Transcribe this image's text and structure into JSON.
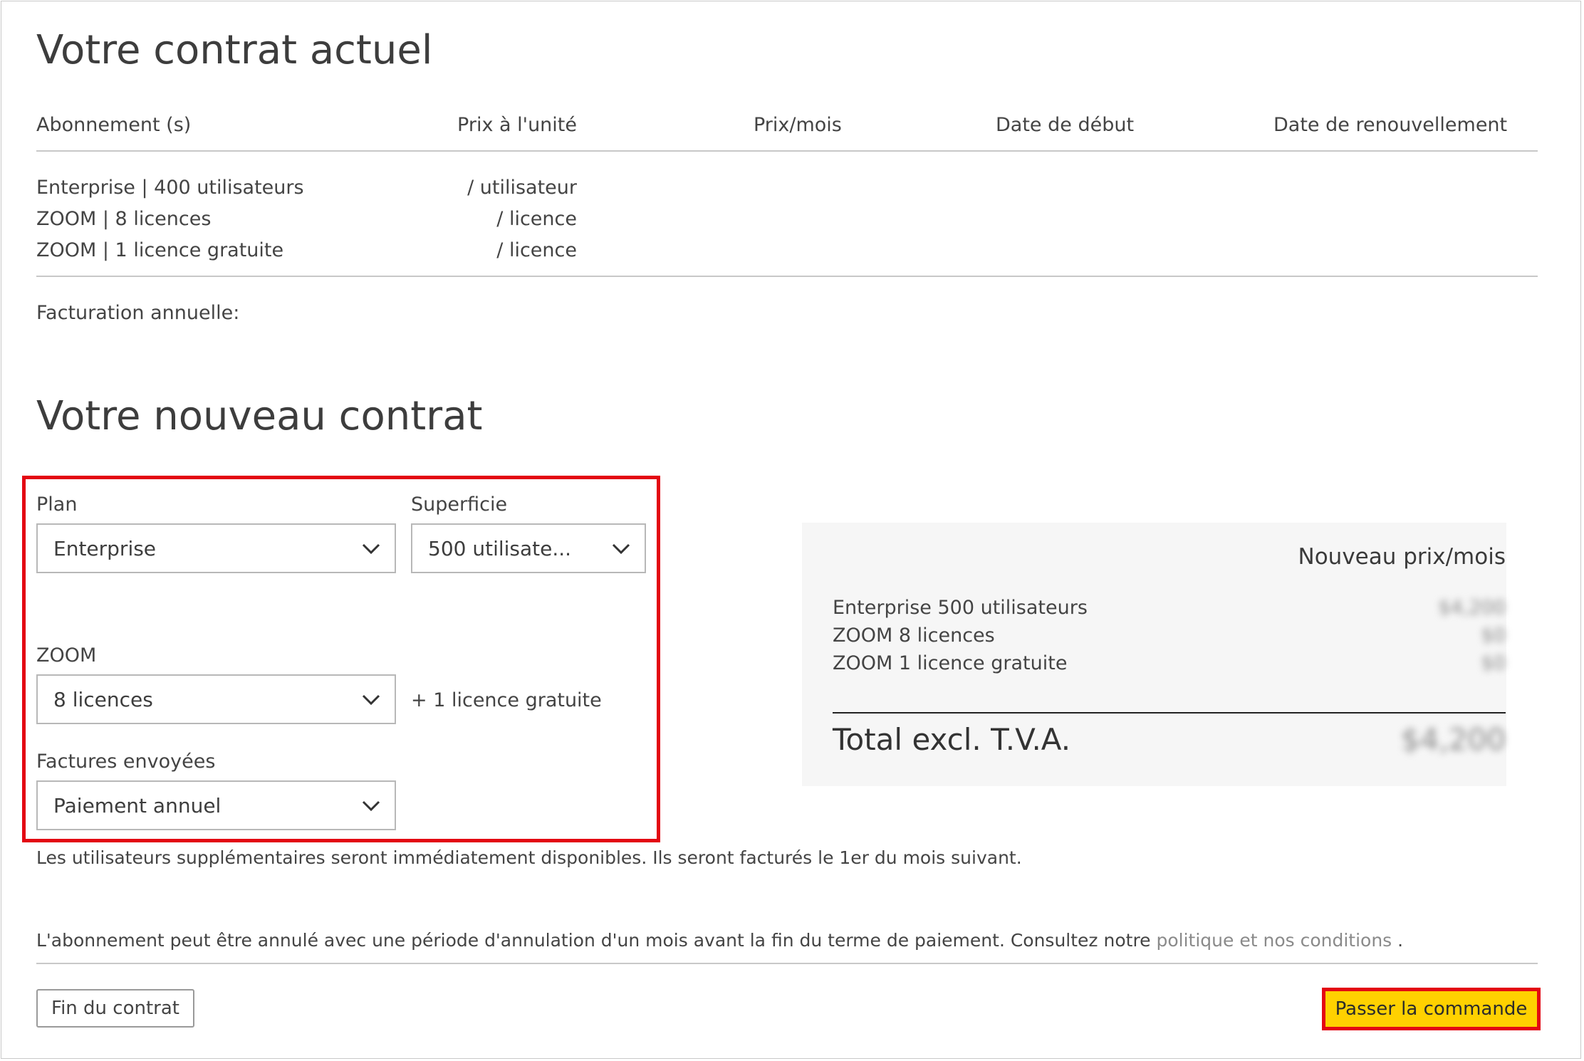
{
  "current": {
    "title": "Votre contrat actuel",
    "headers": {
      "subscription": "Abonnement (s)",
      "unit_price": "Prix à l'unité",
      "monthly_price": "Prix/mois",
      "start_date": "Date de début",
      "renewal_date": "Date de renouvellement"
    },
    "rows": [
      {
        "name": "Enterprise | 400 utilisateurs",
        "unit": "/ utilisateur"
      },
      {
        "name": "ZOOM | 8 licences",
        "unit": "/ licence"
      },
      {
        "name": "ZOOM | 1 licence gratuite",
        "unit": "/ licence"
      }
    ],
    "billing_label": "Facturation annuelle:"
  },
  "new": {
    "title": "Votre nouveau contrat",
    "plan": {
      "label": "Plan",
      "value": "Enterprise"
    },
    "size": {
      "label": "Superficie",
      "value": "500 utilisate..."
    },
    "zoom": {
      "label": "ZOOM",
      "value": "8 licences",
      "extra": "+ 1 licence gratuite"
    },
    "invoices": {
      "label": "Factures envoyées",
      "value": "Paiement annuel"
    }
  },
  "summary": {
    "title": "Nouveau prix/mois",
    "lines": [
      {
        "label": "Enterprise 500 utilisateurs",
        "amount": "$4,200"
      },
      {
        "label": "ZOOM 8 licences",
        "amount": "$0"
      },
      {
        "label": "ZOOM 1 licence gratuite",
        "amount": "$0"
      }
    ],
    "total_label": "Total excl. T.V.A.",
    "total_amount": "$4,200"
  },
  "notes": {
    "additional_users": "Les utilisateurs supplémentaires seront immédiatement disponibles. Ils seront facturés le 1er du mois suivant.",
    "cancel_text": "L'abonnement peut être annulé avec une période d'annulation d'un mois avant la fin du terme de paiement. Consultez notre ",
    "cancel_link": "politique et nos conditions",
    "cancel_end": " ."
  },
  "actions": {
    "end_contract": "Fin du contrat",
    "place_order": "Passer la commande"
  },
  "colors": {
    "accent": "#ffd100",
    "highlight": "#e30613"
  }
}
